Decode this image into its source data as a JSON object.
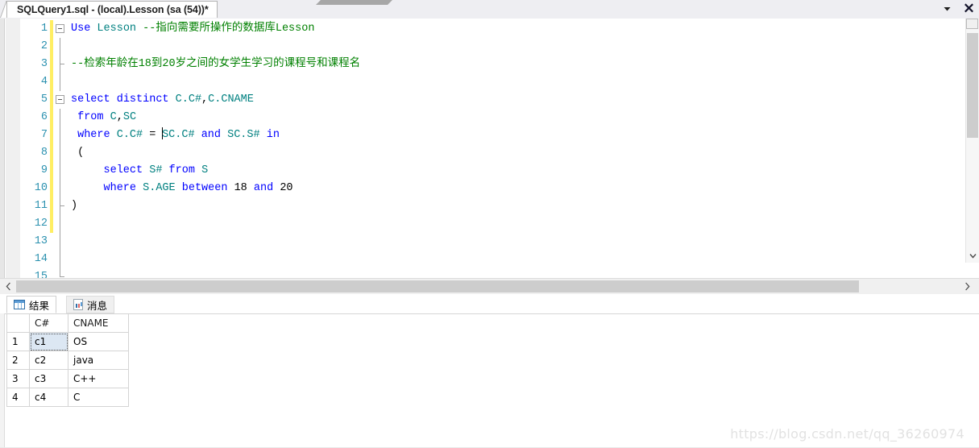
{
  "window": {
    "tab_title": "SQLQuery1.sql - (local).Lesson (sa (54))*",
    "dropdown_icon": "chevron-down-icon",
    "close_icon": "close-icon"
  },
  "editor": {
    "lines": [
      {
        "number": "1",
        "changed": true,
        "outline": "collapse-box",
        "tokens": [
          {
            "t": "kw",
            "v": "Use"
          },
          {
            "t": "pl",
            "v": " "
          },
          {
            "t": "id",
            "v": "Lesson"
          },
          {
            "t": "pl",
            "v": " "
          },
          {
            "t": "cm",
            "v": "--指向需要所操作的数据库Lesson"
          }
        ]
      },
      {
        "number": "2",
        "changed": true,
        "outline": "vline",
        "tokens": []
      },
      {
        "number": "3",
        "changed": true,
        "outline": "tick",
        "tokens": [
          {
            "t": "cm",
            "v": "--检索年龄在18到20岁之间的女学生学习的课程号和课程名"
          }
        ]
      },
      {
        "number": "4",
        "changed": true,
        "outline": "vline",
        "tokens": []
      },
      {
        "number": "5",
        "changed": true,
        "outline": "collapse-box",
        "tokens": [
          {
            "t": "kw",
            "v": "select"
          },
          {
            "t": "pl",
            "v": " "
          },
          {
            "t": "kw",
            "v": "distinct"
          },
          {
            "t": "pl",
            "v": " "
          },
          {
            "t": "id",
            "v": "C.C#"
          },
          {
            "t": "pl",
            "v": ","
          },
          {
            "t": "id",
            "v": "C.CNAME"
          }
        ]
      },
      {
        "number": "6",
        "changed": true,
        "outline": "vline",
        "tokens": [
          {
            "t": "kw",
            "v": " from"
          },
          {
            "t": "pl",
            "v": " "
          },
          {
            "t": "id",
            "v": "C"
          },
          {
            "t": "pl",
            "v": ","
          },
          {
            "t": "id",
            "v": "SC"
          }
        ]
      },
      {
        "number": "7",
        "changed": true,
        "outline": "vline",
        "caret_after": 4,
        "tokens": [
          {
            "t": "kw",
            "v": " where"
          },
          {
            "t": "pl",
            "v": " "
          },
          {
            "t": "id",
            "v": "C.C#"
          },
          {
            "t": "pl",
            "v": " = "
          },
          {
            "t": "id",
            "v": "SC.C#"
          },
          {
            "t": "pl",
            "v": " "
          },
          {
            "t": "kw",
            "v": "and"
          },
          {
            "t": "pl",
            "v": " "
          },
          {
            "t": "id",
            "v": "SC.S#"
          },
          {
            "t": "pl",
            "v": " "
          },
          {
            "t": "kw",
            "v": "in"
          }
        ]
      },
      {
        "number": "8",
        "changed": true,
        "outline": "vline",
        "tokens": [
          {
            "t": "pl",
            "v": " ("
          }
        ]
      },
      {
        "number": "9",
        "changed": true,
        "outline": "vline",
        "tokens": [
          {
            "t": "kw",
            "v": "     select"
          },
          {
            "t": "pl",
            "v": " "
          },
          {
            "t": "id",
            "v": "S#"
          },
          {
            "t": "pl",
            "v": " "
          },
          {
            "t": "kw",
            "v": "from"
          },
          {
            "t": "pl",
            "v": " "
          },
          {
            "t": "id",
            "v": "S"
          }
        ]
      },
      {
        "number": "10",
        "changed": true,
        "outline": "vline",
        "tokens": [
          {
            "t": "kw",
            "v": "     where"
          },
          {
            "t": "pl",
            "v": " "
          },
          {
            "t": "id",
            "v": "S.AGE"
          },
          {
            "t": "pl",
            "v": " "
          },
          {
            "t": "kw",
            "v": "between"
          },
          {
            "t": "pl",
            "v": " "
          },
          {
            "t": "num",
            "v": "18"
          },
          {
            "t": "pl",
            "v": " "
          },
          {
            "t": "kw",
            "v": "and"
          },
          {
            "t": "pl",
            "v": " "
          },
          {
            "t": "num",
            "v": "20"
          }
        ]
      },
      {
        "number": "11",
        "changed": true,
        "outline": "tick",
        "tokens": [
          {
            "t": "pl",
            "v": ")"
          }
        ]
      },
      {
        "number": "12",
        "changed": true,
        "outline": "vline",
        "tokens": []
      },
      {
        "number": "13",
        "changed": false,
        "outline": "vline",
        "tokens": []
      },
      {
        "number": "14",
        "changed": false,
        "outline": "vline",
        "tokens": []
      },
      {
        "number": "15",
        "changed": false,
        "outline": "end",
        "tokens": []
      }
    ]
  },
  "scrollbars": {
    "v_up_icon": "chevron-up-icon",
    "v_down_icon": "chevron-down-icon",
    "h_left_icon": "chevron-left-icon",
    "h_right_icon": "chevron-right-icon"
  },
  "results": {
    "tabs": [
      {
        "label": "结果",
        "icon": "grid-icon",
        "active": true
      },
      {
        "label": "消息",
        "icon": "message-icon",
        "active": false
      }
    ],
    "columns": [
      "",
      "C#",
      "CNAME"
    ],
    "rows": [
      {
        "num": "1",
        "c": "c1",
        "cname": "OS",
        "selected": true
      },
      {
        "num": "2",
        "c": "c2",
        "cname": "java",
        "selected": false
      },
      {
        "num": "3",
        "c": "c3",
        "cname": "C++",
        "selected": false
      },
      {
        "num": "4",
        "c": "c4",
        "cname": "C",
        "selected": false
      }
    ]
  },
  "watermark": {
    "text": "https://blog.csdn.net/qq_36260974"
  },
  "colors": {
    "keyword": "#0000ff",
    "identifier": "#008080",
    "comment": "#008000",
    "linenumber": "#2b91af",
    "changebar": "#ffee62",
    "selection": "#dce7f3"
  }
}
